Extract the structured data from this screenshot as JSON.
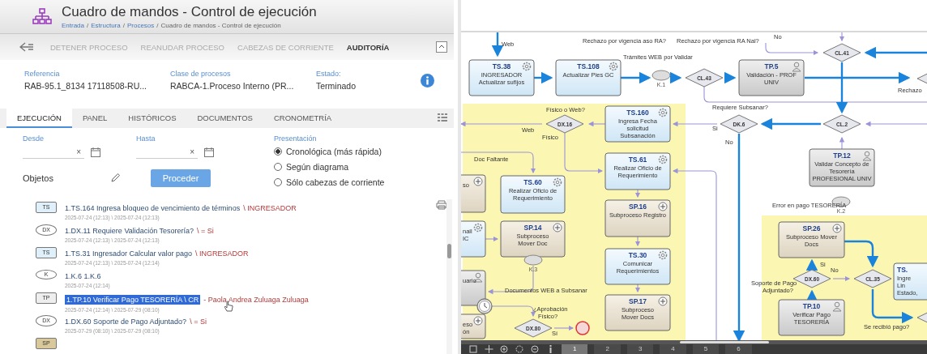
{
  "header": {
    "title": "Cuadro de mandos - Control de ejecución",
    "separator": "/",
    "breadcrumbs": [
      "Entrada",
      "Estructura",
      "Procesos",
      "Cuadro de mandos - Control de ejecución"
    ]
  },
  "actions": [
    {
      "label": "DETENER PROCESO",
      "disabled": true
    },
    {
      "label": "REANUDAR PROCESO",
      "disabled": true
    },
    {
      "label": "CABEZAS DE CORRIENTE",
      "disabled": true
    },
    {
      "label": "AUDITORÍA",
      "disabled": false
    }
  ],
  "info": [
    {
      "label": "Referencia",
      "value": "RAB-95.1_8134 17118508-RU..."
    },
    {
      "label": "Clase de procesos",
      "value": "RABCA-1.Proceso Interno (PR..."
    },
    {
      "label": "Estado:",
      "value": "Terminado"
    }
  ],
  "tabs": [
    {
      "label": "EJECUCIÓN",
      "selected": true
    },
    {
      "label": "PANEL",
      "selected": false
    },
    {
      "label": "HISTÓRICOS",
      "selected": false
    },
    {
      "label": "DOCUMENTOS",
      "selected": false
    },
    {
      "label": "CRONOMETRÍA",
      "selected": false
    }
  ],
  "filters": {
    "from_label": "Desde",
    "to_label": "Hasta",
    "clear_glyph": "×",
    "objects_label": "Objetos",
    "submit": "Proceder"
  },
  "presentation": {
    "label": "Presentación",
    "options": [
      {
        "label": "Cronológica (más rápida)",
        "selected": true
      },
      {
        "label": "Según diagrama",
        "selected": false
      },
      {
        "label": "Sólo cabezas de corriente",
        "selected": false
      }
    ]
  },
  "steps": [
    {
      "kind": "TS",
      "badge": "TS",
      "title": "1.TS.164 Ingresa bloqueo de vencimiento de términos",
      "actor": "\\ INGRESADOR",
      "dates": "2025-07-24 (12:13) \\ 2025-07-24 (12:13)",
      "selected": false
    },
    {
      "kind": "DX",
      "badge": "DX",
      "title": "1.DX.11 Requiere Validación  Tesorería?",
      "actor": "\\ = Si",
      "dates": "2025-07-24 (12:13) \\ 2025-07-24 (12:13)",
      "selected": false
    },
    {
      "kind": "TS",
      "badge": "TS",
      "title": "1.TS.31 Ingresador Calcular valor pago",
      "actor": "\\ INGRESADOR",
      "dates": "2025-07-24 (12:13) \\ 2025-07-24 (12:14)",
      "selected": false
    },
    {
      "kind": "K",
      "badge": "K",
      "title": "1.K.6 1.K.6",
      "dates": "2025-07-24 (12:14)",
      "selected": false
    },
    {
      "kind": "TP",
      "badge": "TP",
      "title": "1.TP.10 Verificar Pago TESORERÍA \\ CR",
      "actor": "- Paola Andrea Zuluaga Zuluaga",
      "dates": "2025-07-24 (12:14) \\ 2025-07-29 (08:10)",
      "selected": true
    },
    {
      "kind": "DX",
      "badge": "DX",
      "title": "1.DX.60 Soporte de Pago  Adjuntado?",
      "actor": "\\ = Si",
      "dates": "2025-07-29 (08:10) \\ 2025-07-29 (08:10)",
      "selected": false
    },
    {
      "kind": "SP",
      "badge": "SP",
      "selected": false
    }
  ],
  "diagram": {
    "nodes": [
      {
        "kind": "task",
        "id": "TS.38",
        "lines": [
          "INGRESADOR",
          "Actualizar sufijos"
        ]
      },
      {
        "kind": "task",
        "id": "TS.108",
        "lines": [
          "Actualizar Pies GC"
        ]
      },
      {
        "kind": "event",
        "id": "K.1"
      },
      {
        "kind": "gateway",
        "id": "CL.43"
      },
      {
        "kind": "user",
        "id": "TP.5",
        "lines": [
          "Validación - PROF",
          "UNIV"
        ]
      },
      {
        "kind": "gateway",
        "id": "CL.41"
      },
      {
        "kind": "gateway"
      },
      {
        "kind": "gateway",
        "id": "DX.16"
      },
      {
        "kind": "task",
        "id": "TS.160",
        "lines": [
          "Ingresa Fecha",
          "solicitud",
          "Subsanación"
        ]
      },
      {
        "kind": "gateway",
        "id": "DK.6"
      },
      {
        "kind": "gateway",
        "id": "CL.2"
      },
      {
        "kind": "subprocess",
        "lines": [
          "so"
        ]
      },
      {
        "kind": "task",
        "id": "TS.60",
        "lines": [
          "Realizar Oficio de",
          "Requerimiento"
        ]
      },
      {
        "kind": "task",
        "id": "TS.61",
        "lines": [
          "Realizar Oficio de",
          "Requerimiento"
        ]
      },
      {
        "kind": "user",
        "id": "TP.12",
        "lines": [
          "Validar Concepto de",
          "Tesorería",
          "PROFESIONAL UNIV"
        ]
      },
      {
        "kind": "task",
        "lines": [
          "nail",
          "IC"
        ]
      },
      {
        "kind": "subprocess",
        "id": "SP.14",
        "lines": [
          "Subproceso",
          "Mover Doc"
        ]
      },
      {
        "kind": "subprocess",
        "id": "SP.16",
        "lines": [
          "Subproceso Registro"
        ]
      },
      {
        "kind": "event",
        "id": "K.2"
      },
      {
        "kind": "subprocess",
        "id": "SP.26",
        "lines": [
          "Subproceso Mover",
          "Docs"
        ]
      },
      {
        "kind": "user",
        "lines": [
          "uario"
        ]
      },
      {
        "kind": "event",
        "id": "K.3"
      },
      {
        "kind": "task",
        "id": "TS.30",
        "lines": [
          "Comunicar",
          "Requerimientos"
        ]
      },
      {
        "kind": "gateway",
        "id": "DX.60"
      },
      {
        "kind": "gateway",
        "id": "CL.35"
      },
      {
        "kind": "task",
        "id": "TS.",
        "lines": [
          "Ingre",
          "Lin",
          "Estado,"
        ]
      },
      {
        "kind": "subprocess",
        "lines": [
          "eso",
          "ón"
        ]
      },
      {
        "kind": "timer"
      },
      {
        "kind": "gateway",
        "id": "DX.80"
      },
      {
        "kind": "end"
      },
      {
        "kind": "subprocess",
        "id": "SP.17",
        "lines": [
          "Subproceso",
          "Mover Docs"
        ]
      },
      {
        "kind": "user",
        "id": "TP.10",
        "lines": [
          "Verificar Pago",
          "TESORERÍA"
        ]
      },
      {
        "kind": "gateway"
      }
    ],
    "labels": [
      "Web",
      "Rechazo por vigencia aso RA?",
      "Rechazo por vigencia RA Nal?",
      "No",
      "Trámites WEB por Validar",
      "Rechazo",
      "Físico o Web?",
      "Web",
      "Físico",
      "Requiere Subsanar?",
      "Si",
      "No",
      "Doc Faltante",
      "Documentos WEB a Subsanar",
      "¿Aprobación",
      "Físico?",
      "Sí",
      "Error en pago TESORERÍA",
      "Si",
      "No",
      "Soporte de Pago",
      "Adjuntado?",
      "Se recibió pago?"
    ],
    "pages": [
      {
        "label": "1",
        "selected": true
      },
      {
        "label": "2",
        "selected": false
      },
      {
        "label": "3",
        "selected": false
      },
      {
        "label": "4",
        "selected": false
      },
      {
        "label": "5",
        "selected": false
      },
      {
        "label": "6",
        "selected": false
      }
    ]
  }
}
